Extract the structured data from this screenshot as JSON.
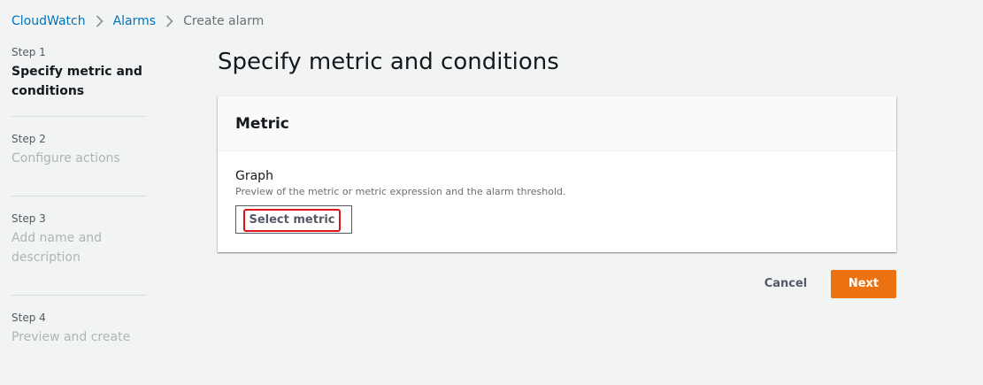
{
  "breadcrumb": {
    "items": [
      "CloudWatch",
      "Alarms",
      "Create alarm"
    ],
    "separator_icon": "chevron-right-icon"
  },
  "steps": [
    {
      "number": "Step 1",
      "title": "Specify metric and conditions",
      "active": true
    },
    {
      "number": "Step 2",
      "title": "Configure actions",
      "active": false
    },
    {
      "number": "Step 3",
      "title": "Add name and description",
      "active": false
    },
    {
      "number": "Step 4",
      "title": "Preview and create",
      "active": false
    }
  ],
  "page": {
    "title": "Specify metric and conditions"
  },
  "metric_panel": {
    "title": "Metric",
    "graph_label": "Graph",
    "graph_description": "Preview of the metric or metric expression and the alarm threshold.",
    "select_metric_label": "Select metric"
  },
  "footer": {
    "cancel_label": "Cancel",
    "next_label": "Next"
  },
  "colors": {
    "link": "#0073bb",
    "primary_button": "#ec7211",
    "highlight_outline": "#e0121a",
    "background": "#f2f3f3"
  }
}
